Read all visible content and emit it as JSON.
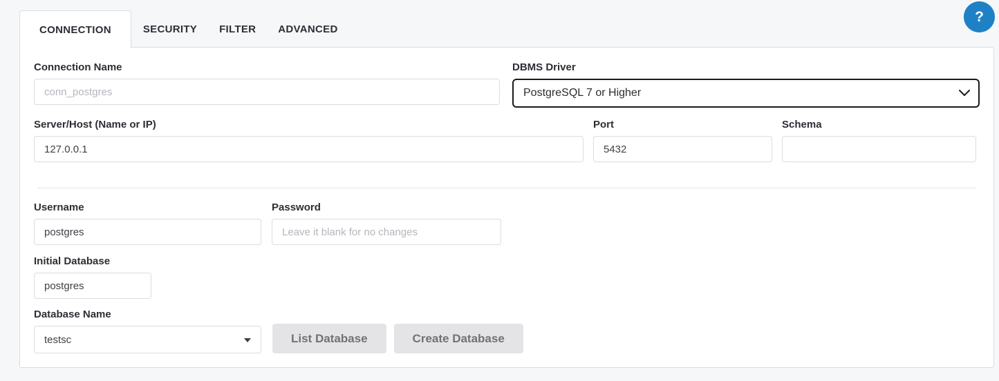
{
  "tabs": {
    "items": [
      {
        "label": "CONNECTION",
        "active": true
      },
      {
        "label": "SECURITY",
        "active": false
      },
      {
        "label": "FILTER",
        "active": false
      },
      {
        "label": "ADVANCED",
        "active": false
      }
    ]
  },
  "help": {
    "label": "?"
  },
  "colors": {
    "help_blue": "#1e81c6",
    "panel_border": "#d9dce1",
    "focused_select_border": "#19191c",
    "button_gray": "#e4e4e6",
    "button_text": "#717177",
    "page_background": "#f6f7f9"
  },
  "form": {
    "connection_name": {
      "label": "Connection Name",
      "placeholder": "conn_postgres"
    },
    "dbms_driver": {
      "label": "DBMS Driver",
      "selected": "PostgreSQL 7 or Higher"
    },
    "server_host": {
      "label": "Server/Host (Name or IP)",
      "value": "127.0.0.1"
    },
    "port": {
      "label": "Port",
      "value": "5432"
    },
    "schema": {
      "label": "Schema",
      "value": ""
    },
    "username": {
      "label": "Username",
      "value": "postgres"
    },
    "password": {
      "label": "Password",
      "placeholder": "Leave it blank for no changes"
    },
    "initial_database": {
      "label": "Initial Database",
      "value": "postgres"
    },
    "database_name": {
      "label": "Database Name",
      "selected": "testsc"
    }
  },
  "buttons": {
    "list_database": "List Database",
    "create_database": "Create Database"
  }
}
